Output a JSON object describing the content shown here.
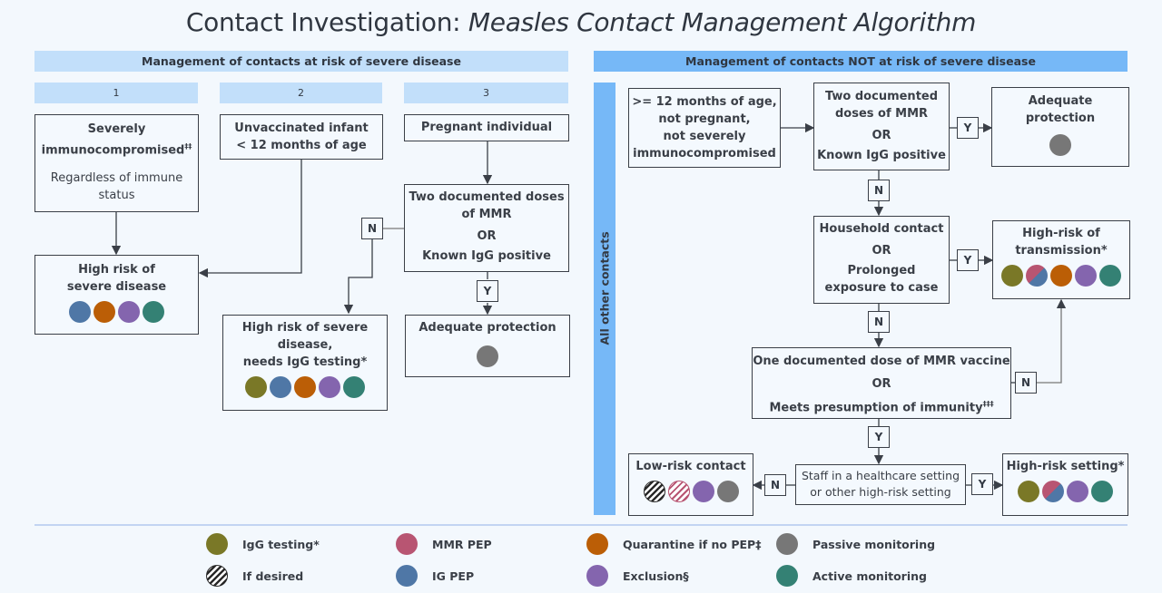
{
  "title": {
    "main": "Contact Investigation: ",
    "italic": "Measles Contact Management  Algorithm"
  },
  "colors": {
    "igg_testing": "#7a7827",
    "mmr_pep": "#b85572",
    "quarantine": "#bb5e06",
    "passive": "#777777",
    "ig_pep": "#4f77a6",
    "exclusion": "#8465ae",
    "active": "#348174",
    "header_light": "#c2dffa",
    "header_dark": "#76b8f7"
  },
  "left": {
    "header": "Management of contacts at risk of severe disease",
    "columns": [
      "1",
      "2",
      "3"
    ],
    "severely_immuno": {
      "title": "Severely immunocompromised",
      "sup": "‡‡",
      "sub": "Regardless of immune status"
    },
    "infant": {
      "line1": "Unvaccinated infant",
      "line2": "< 12 months of age"
    },
    "pregnant": "Pregnant individual",
    "two_doses": {
      "line1": "Two documented doses",
      "line2": "of MMR",
      "or": "OR",
      "line3": "Known IgG positive"
    },
    "high_risk": {
      "line1": "High risk of",
      "line2": "severe disease",
      "dots": [
        "ig_pep",
        "quarantine",
        "exclusion",
        "active"
      ]
    },
    "high_risk_igg": {
      "line1": "High risk of severe",
      "line2": "disease,",
      "line3": "needs IgG testing*",
      "dots": [
        "igg_testing",
        "ig_pep",
        "quarantine",
        "exclusion",
        "active"
      ]
    },
    "adequate": {
      "title": "Adequate protection",
      "dots": [
        "passive"
      ]
    },
    "labels": {
      "n": "N",
      "y": "Y"
    }
  },
  "right": {
    "header": "Management of contacts NOT at risk of severe disease",
    "side_label": "All other contacts",
    "age_box": {
      "line1": ">= 12 months of age,",
      "line2": "not pregnant,",
      "line3": "not severely",
      "line4": "immunocompromised"
    },
    "two_doses": {
      "line1": "Two documented",
      "line2": "doses of MMR",
      "or": "OR",
      "line3": "Known IgG positive"
    },
    "adequate": {
      "line1": "Adequate",
      "line2": "protection",
      "dots": [
        "passive"
      ]
    },
    "household": {
      "line1": "Household contact",
      "or": "OR",
      "line2": "Prolonged",
      "line3": "exposure to case"
    },
    "high_transmission": {
      "line1": "High-risk of",
      "line2": "transmission*",
      "dots": [
        "igg_testing",
        "split",
        "quarantine",
        "exclusion",
        "active"
      ]
    },
    "one_dose": {
      "line1": "One documented dose of MMR vaccine",
      "or": "OR",
      "line2": "Meets presumption of immunity",
      "sup": "‡‡‡"
    },
    "staff": {
      "line1": "Staff in a healthcare setting",
      "line2": "or other high-risk setting"
    },
    "low_risk": {
      "title": "Low-risk contact",
      "dots": [
        "hatch_black",
        "hatch_pink",
        "exclusion",
        "passive"
      ]
    },
    "high_setting": {
      "title": "High-risk setting*",
      "dots": [
        "igg_testing",
        "split",
        "exclusion",
        "active"
      ]
    },
    "labels": {
      "n": "N",
      "y": "Y"
    }
  },
  "legend": [
    {
      "key": "igg_testing",
      "label": "IgG testing*"
    },
    {
      "key": "mmr_pep",
      "label": "MMR PEP"
    },
    {
      "key": "quarantine",
      "label": "Quarantine if no PEP‡"
    },
    {
      "key": "passive",
      "label": "Passive monitoring"
    },
    {
      "key": "hatch_black",
      "label": "If desired"
    },
    {
      "key": "ig_pep",
      "label": "IG PEP"
    },
    {
      "key": "exclusion",
      "label": "Exclusion§"
    },
    {
      "key": "active",
      "label": "Active monitoring"
    }
  ]
}
